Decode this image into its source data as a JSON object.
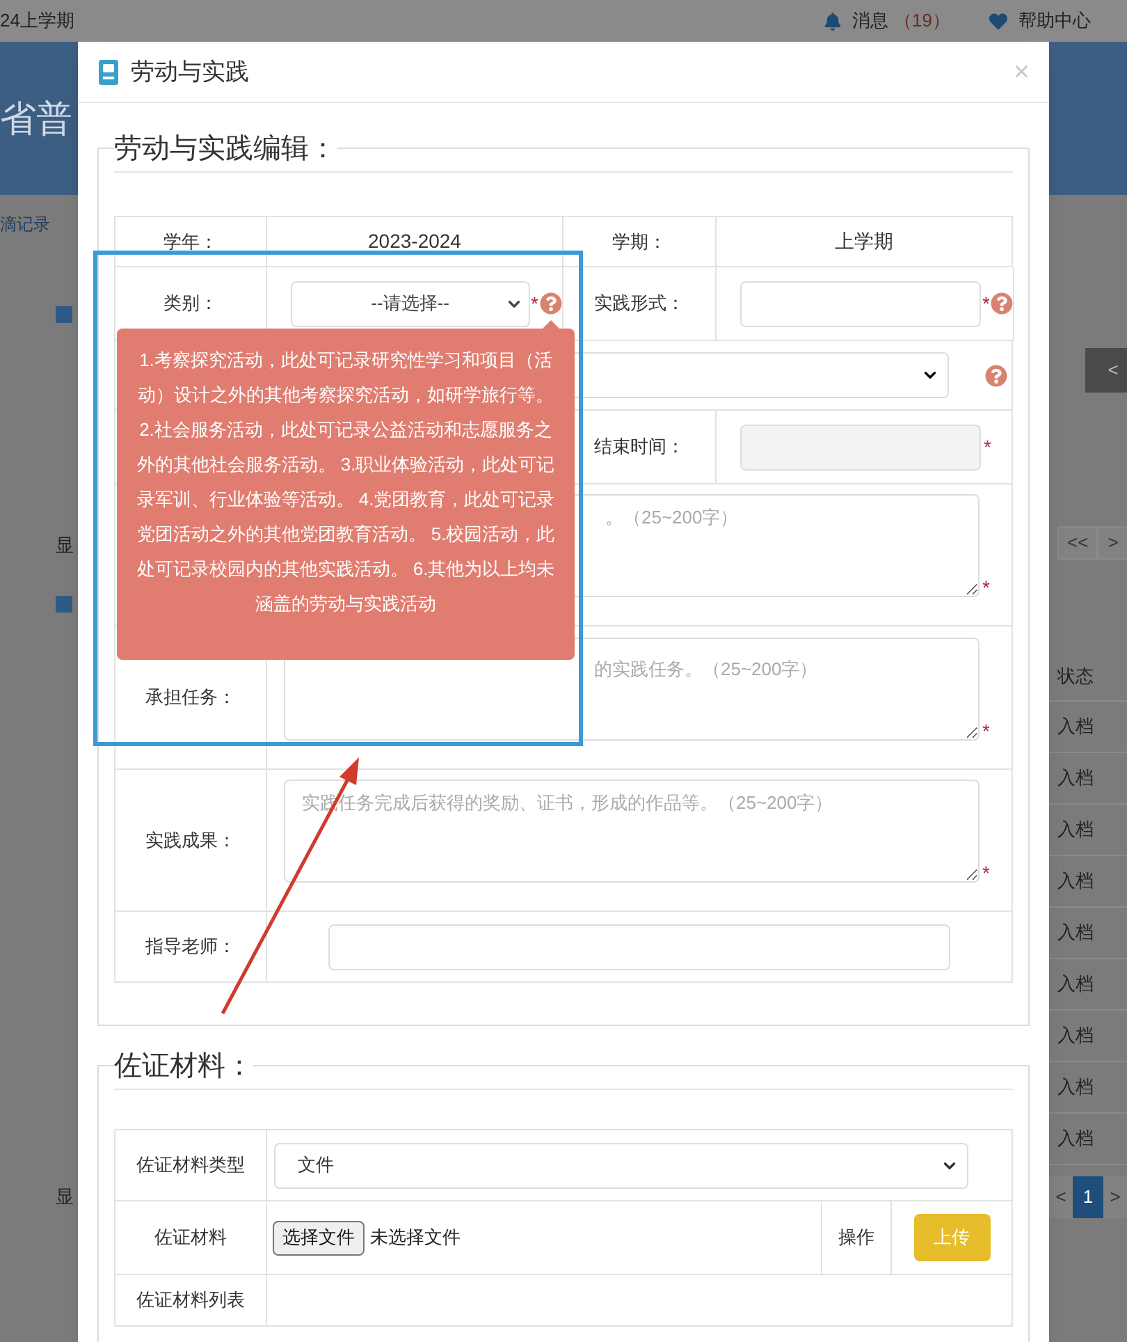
{
  "top_bar": {
    "term": "24上学期",
    "messages_label": "消息",
    "messages_count": "（19）",
    "help": "帮助中心"
  },
  "banner": {
    "title": "省普"
  },
  "background": {
    "breadcrumb": "滴记录",
    "left_labels": [
      "显",
      "显"
    ],
    "back_button": "<",
    "pager_top": [
      "<<",
      ">"
    ],
    "status_header": "状态",
    "status_cells": [
      "入档",
      "入档",
      "入档",
      "入档",
      "入档",
      "入档",
      "入档",
      "入档",
      "入档"
    ],
    "pager_bottom": [
      {
        "label": "<",
        "selected": false
      },
      {
        "label": "1",
        "selected": true
      },
      {
        "label": ">",
        "selected": false
      }
    ]
  },
  "dialog": {
    "title": "劳动与实践",
    "close": "×",
    "edit_section": {
      "legend": "劳动与实践编辑：",
      "school_year": {
        "label": "学年：",
        "value": "2023-2024"
      },
      "semester": {
        "label": "学期：",
        "value": "上学期"
      },
      "category": {
        "label": "类别：",
        "select": "--请选择--",
        "required": "*",
        "help": true
      },
      "practice_form": {
        "label": "实践形式：",
        "required": "*",
        "help": true
      },
      "activity_select": {
        "help": true
      },
      "end_time": {
        "label": "结束时间：",
        "required": "*"
      },
      "content": {
        "placeholder": "。（25~200字）",
        "required": "*"
      },
      "task": {
        "label": "承担任务：",
        "placeholder": "的实践任务。（25~200字）",
        "required": "*"
      },
      "result": {
        "label": "实践成果：",
        "placeholder": "实践任务完成后获得的奖励、证书，形成的作品等。（25~200字）",
        "required": "*"
      },
      "teacher": {
        "label": "指导老师："
      }
    },
    "tooltip": "1.考察探究活动，此处可记录研究性学习和项目（活动）设计之外的其他考察探究活动，如研学旅行等。 2.社会服务活动，此处可记录公益活动和志愿服务之外的其他社会服务活动。 3.职业体验活动，此处可记录军训、行业体验等活动。 4.党团教育，此处可记录党团活动之外的其他党团教育活动。 5.校园活动，此处可记录校园内的其他实践活动。 6.其他为以上均未涵盖的劳动与实践活动",
    "evidence_section": {
      "legend": "佐证材料：",
      "type_label": "佐证材料类型",
      "type_select": "文件",
      "file_label": "佐证材料",
      "file_button": "选择文件",
      "file_status": "未选择文件",
      "action_label": "操作",
      "upload_button": "上传",
      "list_label": "佐证材料列表"
    }
  }
}
